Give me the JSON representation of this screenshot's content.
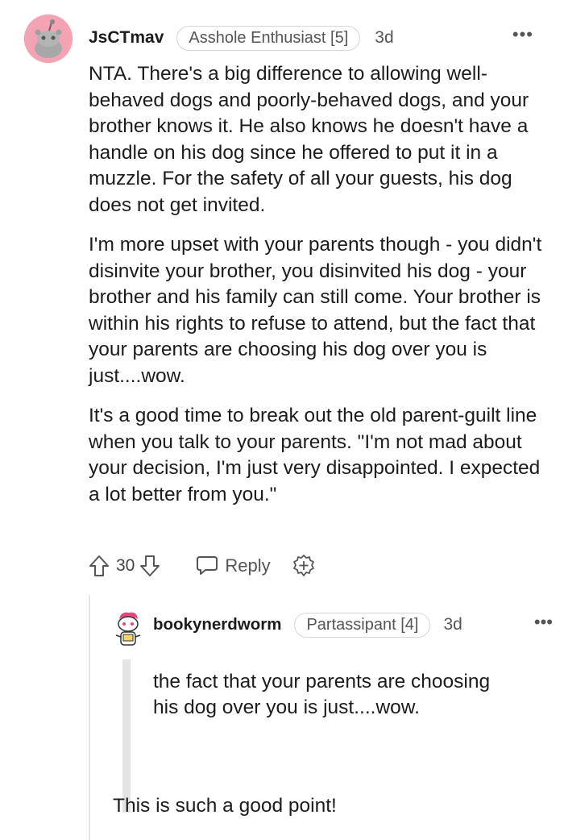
{
  "comment": {
    "username": "JsCTmav",
    "flair": "Asshole Enthusiast [5]",
    "age": "3d",
    "more_label": "•••",
    "paragraphs": [
      "NTA. There's a big difference to allowing well-behaved dogs and poorly-behaved dogs, and your brother knows it. He also knows he doesn't have a handle on his dog since he offered to put it in a muzzle. For the safety of all your guests, his dog does not get invited.",
      "I'm more upset with your parents though - you didn't disinvite your brother, you disinvited his dog - your brother and his family can still come. Your brother is within his rights to refuse to attend, but the fact that your parents are choosing his dog over you is just....wow.",
      "It's a good time to break out the old parent-guilt line when you talk to your parents. \"I'm not mad about your decision, I'm just very disappointed. I expected a lot better from you.\""
    ],
    "score": "30",
    "reply_label": "Reply",
    "avatar_icon": "snoo-avatar-icon",
    "avatar_color": "#f4a3b4"
  },
  "reply": {
    "username": "bookynerdworm",
    "flair": "Partassipant [4]",
    "age": "3d",
    "more_label": "•••",
    "quote": "the fact that your parents are choosing his dog over you is just....wow.",
    "body": "This is such a good point!",
    "avatar_icon": "snoo-avatar-icon"
  },
  "icons": {
    "upvote": "arrow-up-icon",
    "downvote": "arrow-down-icon",
    "reply": "speech-bubble-icon",
    "award": "award-plus-icon"
  }
}
